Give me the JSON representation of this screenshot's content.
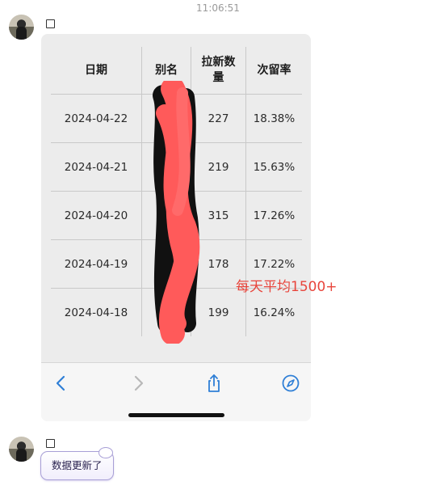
{
  "chat": {
    "timestamp": "11:06:51",
    "annotation": "每天平均1500+",
    "reply_bubble": "数据更新了"
  },
  "table": {
    "headers": [
      "日期",
      "别名",
      "拉新数量",
      "次留率"
    ],
    "rows": [
      {
        "date": "2024-04-22",
        "alias": "",
        "new_users": "227",
        "retention": "18.38%"
      },
      {
        "date": "2024-04-21",
        "alias": "",
        "new_users": "219",
        "retention": "15.63%"
      },
      {
        "date": "2024-04-20",
        "alias": "",
        "new_users": "315",
        "retention": "17.26%"
      },
      {
        "date": "2024-04-19",
        "alias": "",
        "new_users": "178",
        "retention": "17.22%"
      },
      {
        "date": "2024-04-18",
        "alias": "",
        "new_users": "199",
        "retention": "16.24%"
      }
    ]
  },
  "browser_toolbar": {
    "buttons": [
      "back-icon",
      "forward-icon",
      "share-icon",
      "compass-icon"
    ],
    "accent_color": "#2f7fd6",
    "disabled_color": "#b8b8b8"
  },
  "colors": {
    "annotation": "#e8453c",
    "redaction_red": "#ff5a5a",
    "redaction_black": "#111111"
  }
}
